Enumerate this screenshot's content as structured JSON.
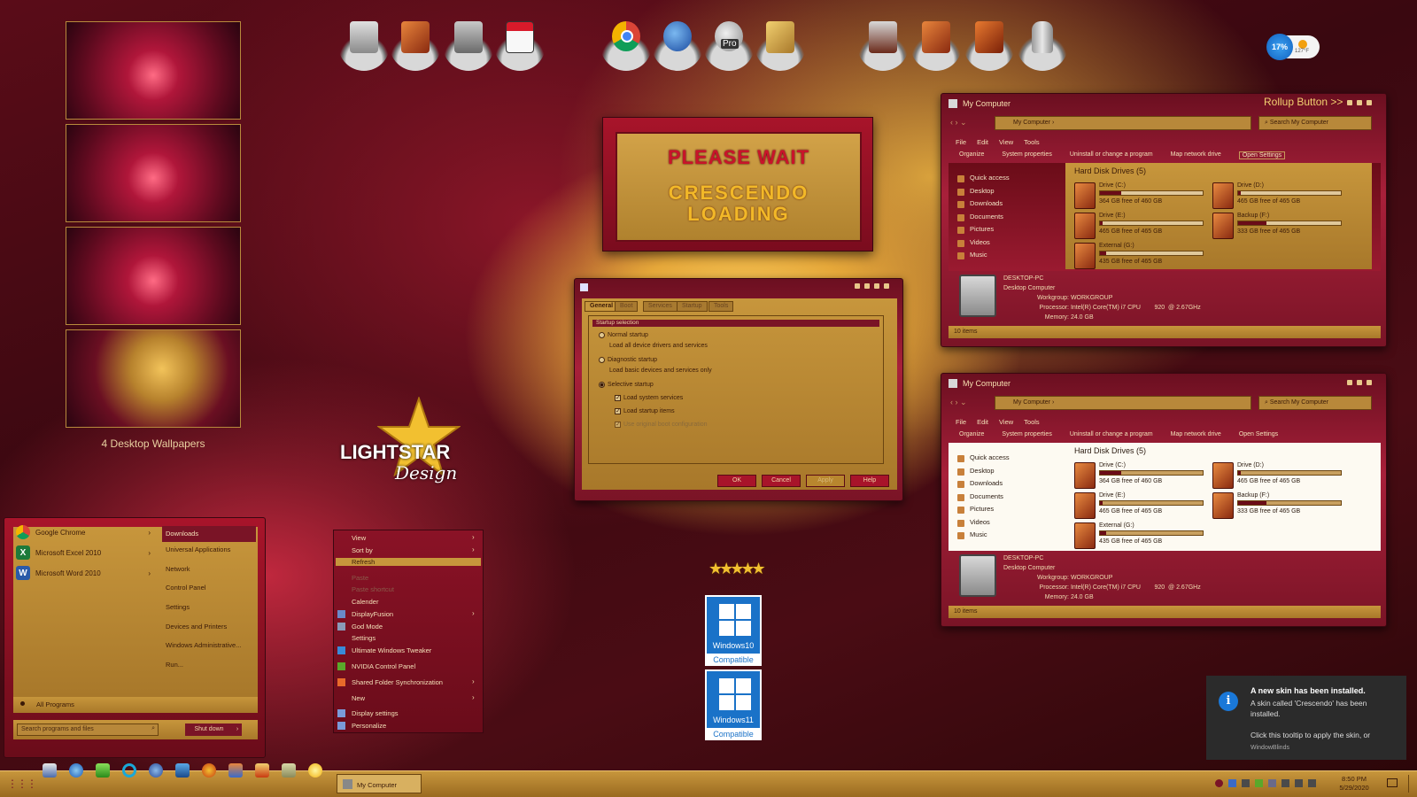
{
  "wallpapers": {
    "caption": "4 Desktop Wallpapers"
  },
  "desktop_icons": [
    "computer-icon",
    "documents-icon",
    "network-icon",
    "calendar-icon",
    "chrome-icon",
    "thunderbird-icon",
    "google-earth-pro-icon",
    "address-book-icon",
    "server-icon",
    "book-icon",
    "notebook-icon",
    "recycle-bin-icon"
  ],
  "earth_badge": "Pro",
  "weather": {
    "percent": "17%",
    "temp": "127°F"
  },
  "splash": {
    "line1": "PLEASE WAIT",
    "line2": "CRESCENDO",
    "line3": "LOADING"
  },
  "logo": {
    "light": "LIGHTSTAR",
    "design": "Design"
  },
  "win1": {
    "title": "My Computer",
    "rollup": "Rollup Button >>",
    "address": "My Computer",
    "search": "Search My Computer",
    "menu": [
      "File",
      "Edit",
      "View",
      "Tools"
    ],
    "commands": [
      "Organize",
      "System properties",
      "Uninstall or change a program",
      "Map network drive",
      "Open Settings"
    ],
    "nav": [
      "Quick access",
      "Desktop",
      "Downloads",
      "Documents",
      "Pictures",
      "Videos",
      "Music"
    ],
    "group": "Hard Disk Drives (5)",
    "drives": [
      {
        "name": "Drive (C:)",
        "free": "364 GB free of 460 GB",
        "used": 0.21
      },
      {
        "name": "Drive (D:)",
        "free": "465 GB free of 465 GB",
        "used": 0.0
      },
      {
        "name": "Drive (E:)",
        "free": "465 GB free of 465 GB",
        "used": 0.0
      },
      {
        "name": "Backup (F:)",
        "free": "333 GB free of 465 GB",
        "used": 0.28
      },
      {
        "name": "External (G:)",
        "free": "435 GB free of 465 GB",
        "used": 0.06
      }
    ],
    "pc_name": "DESKTOP-PC",
    "pc_type": "Desktop Computer",
    "workgroup_label": "Workgroup:",
    "workgroup": "WORKGROUP",
    "processor_label": "Processor:",
    "processor": "Intel(R) Core(TM) i7 CPU        920  @ 2.67GHz",
    "memory_label": "Memory:",
    "memory": "24.0 GB",
    "status": "10 items"
  },
  "win2": {
    "title": "My Computer",
    "address": "My Computer",
    "search": "Search My Computer",
    "menu": [
      "File",
      "Edit",
      "View",
      "Tools"
    ],
    "commands": [
      "Organize",
      "System properties",
      "Uninstall or change a program",
      "Map network drive",
      "Open Settings"
    ],
    "nav": [
      "Quick access",
      "Desktop",
      "Downloads",
      "Documents",
      "Pictures",
      "Videos",
      "Music"
    ],
    "group": "Hard Disk Drives (5)",
    "drives": [
      {
        "name": "Drive (C:)",
        "free": "364 GB free of 460 GB",
        "used": 0.21
      },
      {
        "name": "Drive (D:)",
        "free": "465 GB free of 465 GB",
        "used": 0.0
      },
      {
        "name": "Drive (E:)",
        "free": "465 GB free of 465 GB",
        "used": 0.0
      },
      {
        "name": "Backup (F:)",
        "free": "333 GB free of 465 GB",
        "used": 0.28
      },
      {
        "name": "External (G:)",
        "free": "435 GB free of 465 GB",
        "used": 0.06
      }
    ],
    "pc_name": "DESKTOP-PC",
    "pc_type": "Desktop Computer",
    "workgroup_label": "Workgroup:",
    "workgroup": "WORKGROUP",
    "processor_label": "Processor:",
    "processor": "Intel(R) Core(TM) i7 CPU        920  @ 2.67GHz",
    "memory_label": "Memory:",
    "memory": "24.0 GB",
    "status": "10 items"
  },
  "msconfig": {
    "tabs": [
      "General",
      "Boot",
      "Services",
      "Startup",
      "Tools"
    ],
    "group": "Startup selection",
    "normal": "Normal startup",
    "normal_desc": "Load all device drivers and services",
    "diag": "Diagnostic startup",
    "diag_desc": "Load basic devices and services only",
    "selective": "Selective startup",
    "opt1": "Load system services",
    "opt2": "Load startup items",
    "opt3": "Use original boot configuration",
    "ok": "OK",
    "cancel": "Cancel",
    "apply": "Apply",
    "help": "Help"
  },
  "start_menu": {
    "pinned": [
      {
        "label": "Google Chrome",
        "icon": "chrome-icon"
      },
      {
        "label": "Microsoft Excel 2010",
        "icon": "excel-icon",
        "glyph": "X"
      },
      {
        "label": "Microsoft Word 2010",
        "icon": "word-icon",
        "glyph": "W"
      }
    ],
    "right": [
      "Downloads",
      "Universal Applications",
      "Network",
      "Control Panel",
      "Settings",
      "Devices and Printers",
      "Windows Administrative...",
      "Run..."
    ],
    "all_programs": "All Programs",
    "search_placeholder": "Search programs and files",
    "shutdown": "Shut down"
  },
  "context_menu": [
    {
      "label": "View",
      "sub": true
    },
    {
      "label": "Sort by",
      "sub": true
    },
    {
      "label": "Refresh",
      "hl": true
    },
    {
      "label": "Paste",
      "disabled": true
    },
    {
      "label": "Paste shortcut",
      "disabled": true
    },
    {
      "label": "Calender"
    },
    {
      "label": "DisplayFusion",
      "sub": true,
      "icon": true
    },
    {
      "label": "God Mode",
      "icon": true
    },
    {
      "label": "Settings"
    },
    {
      "label": "Ultimate Windows Tweaker",
      "icon": true
    },
    {
      "label": "NVIDIA Control Panel",
      "icon": true
    },
    {
      "label": "Shared Folder Synchronization",
      "sub": true,
      "icon": true
    },
    {
      "label": "New",
      "sub": true
    },
    {
      "label": "Display settings",
      "icon": true
    },
    {
      "label": "Personalize",
      "icon": true
    }
  ],
  "badges": [
    {
      "title": "Windows10",
      "sub": "Compatible"
    },
    {
      "title": "Windows11",
      "sub": "Compatible"
    }
  ],
  "toast": {
    "title": "A new skin has been installed.",
    "body": "A skin called 'Crescendo' has been installed.",
    "hint": "Click this tooltip to apply the skin, or",
    "source": "WindowBlinds"
  },
  "taskbar": {
    "active_window": "My Computer",
    "time": "8:50 PM",
    "date": "5/29/2020"
  },
  "colors": {
    "accent": "#a8142a",
    "gold": "#c7963c",
    "dark": "#3a0810"
  }
}
